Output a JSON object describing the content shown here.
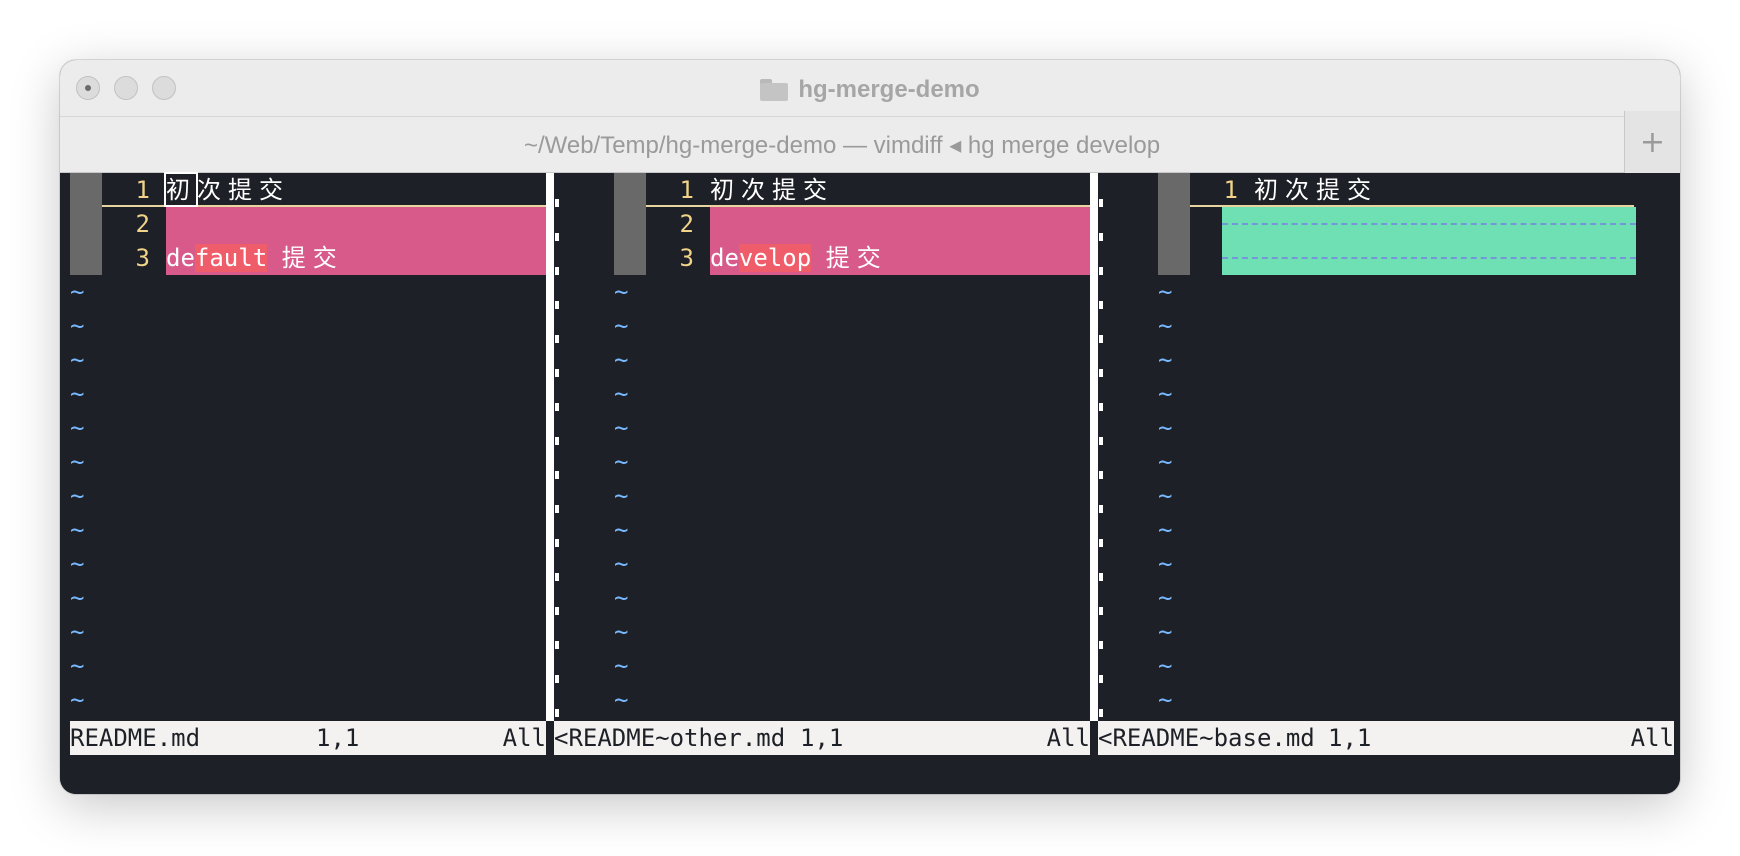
{
  "window": {
    "title": "hg-merge-demo",
    "tab_title": "~/Web/Temp/hg-merge-demo — vimdiff ◂ hg merge develop",
    "new_tab_label": "+"
  },
  "panes": [
    {
      "lines": [
        {
          "num": "1",
          "text": "初次提交"
        },
        {
          "num": "2",
          "text": ""
        },
        {
          "num": "3",
          "prefix": "de",
          "highlight": "fault",
          "suffix": " 提交"
        }
      ],
      "status": {
        "file": "README.md",
        "position": "1,1",
        "scroll": "All"
      }
    },
    {
      "lines": [
        {
          "num": "1",
          "text": "初次提交"
        },
        {
          "num": "2",
          "text": ""
        },
        {
          "num": "3",
          "prefix": "de",
          "highlight": "velop",
          "suffix": " 提交"
        }
      ],
      "status": {
        "file": "<README~other.md",
        "position": "1,1",
        "scroll": "All"
      }
    },
    {
      "lines": [
        {
          "num": "1",
          "text": "初次提交"
        }
      ],
      "status": {
        "file": "<README~base.md",
        "position": "1,1",
        "scroll": "All"
      }
    }
  ],
  "tilde": "~",
  "colors": {
    "background": "#1d2026",
    "changed_line": "#d85a8b",
    "changed_text": "#f05d6a",
    "deleted_line": "#6fe0b3",
    "line_number": "#f1d38a",
    "tilde": "#79b8ff",
    "statusbar": "#f3f2f0"
  }
}
